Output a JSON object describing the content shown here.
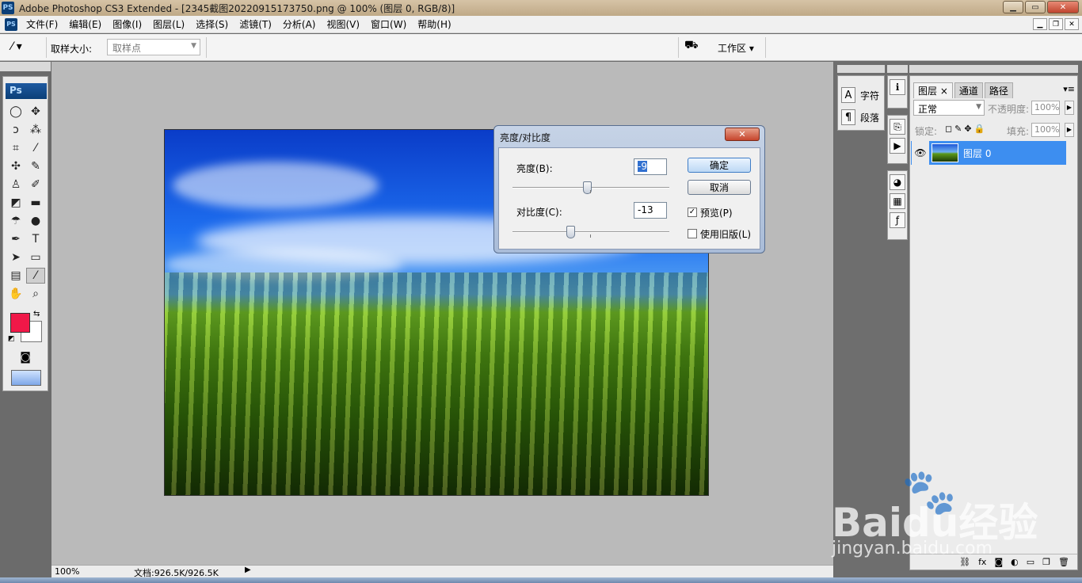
{
  "window": {
    "app_icon": "PS",
    "title": "Adobe Photoshop CS3 Extended - [2345截图20220915173750.png @ 100% (图层 0, RGB/8)]",
    "buttons": {
      "minimize": "▁",
      "maximize": "▭",
      "close": "✕"
    }
  },
  "menu": {
    "items": [
      "文件(F)",
      "编辑(E)",
      "图像(I)",
      "图层(L)",
      "选择(S)",
      "滤镜(T)",
      "分析(A)",
      "视图(V)",
      "窗口(W)",
      "帮助(H)"
    ],
    "doc_buttons": {
      "minimize": "▁",
      "restore": "❐",
      "close": "✕"
    }
  },
  "options_bar": {
    "sample_size_label": "取样大小:",
    "sample_size_value": "取样点",
    "workspace_label": "工作区 ▾"
  },
  "toolbox": {
    "logo": "Ps",
    "foreground_color": "#f01848",
    "background_color": "#ffffff"
  },
  "status_bar": {
    "zoom": "100%",
    "doc_info": "文档:926.5K/926.5K"
  },
  "dialog": {
    "title": "亮度/对比度",
    "brightness_label": "亮度(B):",
    "brightness_value": "-9",
    "contrast_label": "对比度(C):",
    "contrast_value": "-13",
    "ok_label": "确定",
    "cancel_label": "取消",
    "preview_label": "预览(P)",
    "preview_checked": true,
    "legacy_label": "使用旧版(L)",
    "legacy_checked": false
  },
  "char_panel": {
    "items": [
      {
        "icon": "A",
        "label": "字符"
      },
      {
        "icon": "¶",
        "label": "段落"
      }
    ]
  },
  "layers_panel": {
    "tabs": [
      "图层 ×",
      "通道",
      "路径"
    ],
    "blend_mode": "正常",
    "opacity_label": "不透明度:",
    "opacity_value": "100%",
    "lock_label": "锁定:",
    "fill_label": "填充:",
    "fill_value": "100%",
    "layers": [
      {
        "name": "图层 0",
        "visible": true,
        "selected": true
      }
    ]
  },
  "watermark": {
    "brand": "Bai",
    "brand2": "du",
    "brand_cn": "经验",
    "url": "jingyan.baidu.com"
  }
}
